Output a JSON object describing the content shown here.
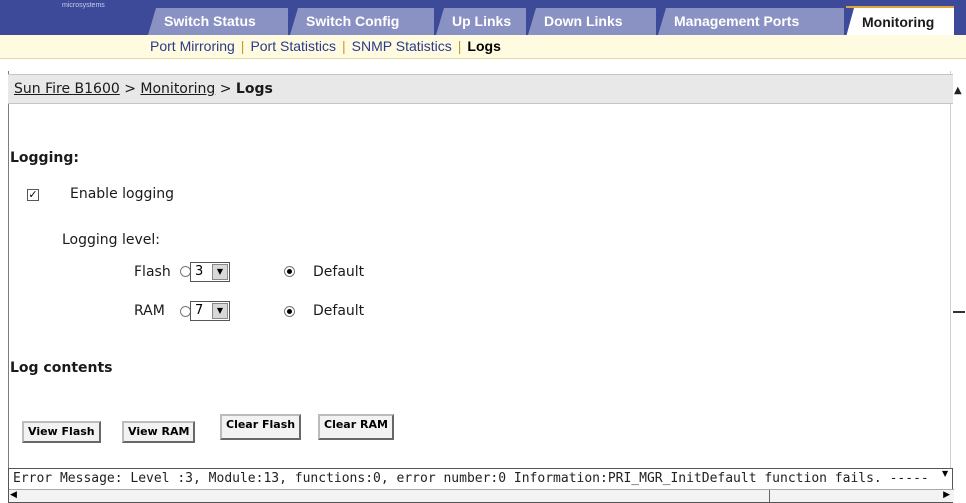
{
  "brand": {
    "logo_text": "microsystems"
  },
  "tabs": [
    {
      "label": "Switch Status"
    },
    {
      "label": "Switch Config"
    },
    {
      "label": "Up Links"
    },
    {
      "label": "Down Links"
    },
    {
      "label": "Management Ports"
    },
    {
      "label": "Monitoring"
    }
  ],
  "subnav": {
    "items": [
      "Port Mirroring",
      "Port Statistics",
      "SNMP Statistics",
      "Logs"
    ],
    "separator": "|"
  },
  "breadcrumb": {
    "root": "Sun Fire B1600",
    "sep": ">",
    "section": "Monitoring",
    "current": "Logs"
  },
  "logging": {
    "heading": "Logging:",
    "enable_label": "Enable logging",
    "enable_checked": true,
    "level_label": "Logging level:",
    "flash": {
      "label": "Flash",
      "value": "3",
      "default_label": "Default",
      "default_selected": true
    },
    "ram": {
      "label": "RAM",
      "value": "7",
      "default_label": "Default",
      "default_selected": true
    }
  },
  "log_contents": {
    "heading": "Log contents",
    "buttons": [
      "View Flash",
      "View RAM",
      "Clear Flash",
      "Clear RAM"
    ],
    "text": "Error Message: Level :3, Module:13, functions:0, error number:0 Information:PRI_MGR_InitDefault function fails. -----"
  },
  "colors": {
    "tab_bar": "#3d4a9a",
    "tab": "#8a92c4",
    "active_accent": "#e2a43a",
    "subnav_bg": "#fffbe0"
  }
}
